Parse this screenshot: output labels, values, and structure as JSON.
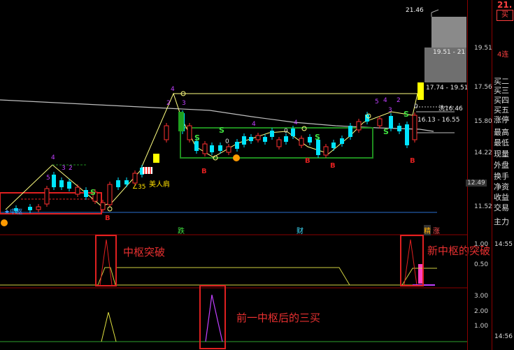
{
  "axis": {
    "price_top": "21.46",
    "price_ticks": [
      "19.51",
      "17.56",
      "15.80",
      "14.22",
      "12.49",
      "11.52"
    ],
    "ind1_ticks": [
      "1.00",
      "0.50"
    ],
    "ind2_ticks": [
      "3.00",
      "2.00",
      "1.00"
    ]
  },
  "zones": {
    "z1": "19.51 - 21",
    "z2": "17.74 - 19.51",
    "z3": "16.13 - 16.55",
    "flush": "洗16.46"
  },
  "side_panel": {
    "top_price": "21.",
    "buy_button": "买",
    "badge": "4连",
    "items": [
      "买二",
      "买三",
      "买四",
      "买五",
      "涨停",
      "最高",
      "最低",
      "现量",
      "外盘",
      "换手",
      "净资",
      "收益",
      "交易",
      "主力"
    ],
    "time1": "14:55",
    "time2": "14:56"
  },
  "labels": {
    "beauty": "美人肩",
    "angle": "∠35",
    "fall": "跌",
    "finance": "财",
    "jing": "精",
    "rise": "涨",
    "buy_b": "B",
    "sell_s": "S",
    "star": "★中枢"
  },
  "annotations": {
    "a1": "中枢突破",
    "a2": "新中枢的突破",
    "a3": "前一中枢后的三买"
  },
  "colors": {
    "up": "#ff3030",
    "down": "#00e5ff",
    "ma": "#c8c8c8",
    "zigzag": "#ffff80",
    "box_green": "#1e8c1e",
    "box_red": "#e02020",
    "indicator": "#ffff60",
    "purple": "#c040ff"
  }
}
